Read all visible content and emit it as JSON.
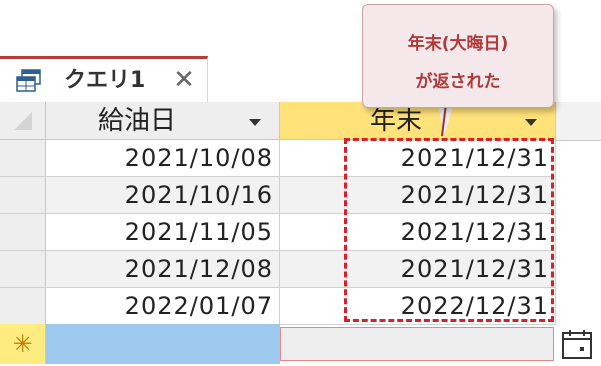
{
  "tab": {
    "label": "クエリ1",
    "close_glyph": "✕",
    "icon": "query-icon"
  },
  "columns": [
    {
      "label": "給油日"
    },
    {
      "label": "年末"
    }
  ],
  "rows": [
    [
      "2021/10/08",
      "2021/12/31"
    ],
    [
      "2021/10/16",
      "2021/12/31"
    ],
    [
      "2021/11/05",
      "2021/12/31"
    ],
    [
      "2021/12/08",
      "2021/12/31"
    ],
    [
      "2022/01/07",
      "2022/12/31"
    ]
  ],
  "new_record": {
    "marker": "✳",
    "date_picker_icon": "calendar-icon"
  },
  "callout": {
    "line1": "年末(大晦日)",
    "line2": "が返された"
  },
  "colors": {
    "tab_accent": "#b83b3b",
    "selected_header": "#ffe27a",
    "highlight_border": "#d8202a",
    "callout_text": "#b03a3a",
    "new_row_cell": "#9ec9ee"
  }
}
